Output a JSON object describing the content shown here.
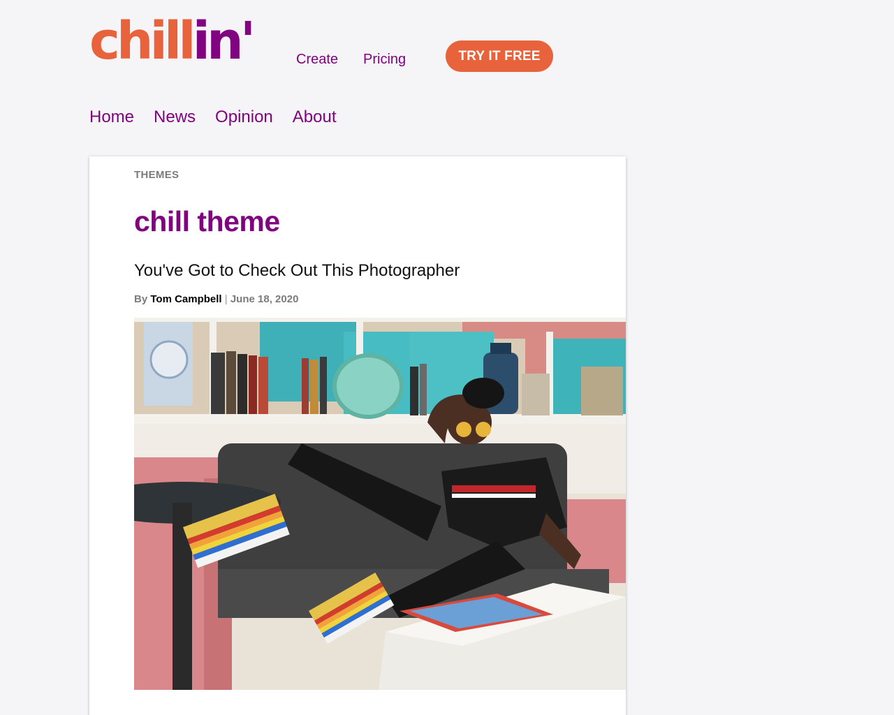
{
  "brand": {
    "logo_part1": "chill",
    "logo_part2": "in'",
    "orange": "#e8633b",
    "purple": "#800380"
  },
  "topnav": {
    "create": "Create",
    "pricing": "Pricing",
    "cta": "TRY IT FREE"
  },
  "mainnav": {
    "items": [
      "Home",
      "News",
      "Opinion",
      "About"
    ]
  },
  "article": {
    "category": "THEMES",
    "title": "chill theme",
    "headline": "You've Got to Check Out This Photographer",
    "by": "By",
    "author": "Tom Campbell",
    "separator": "|",
    "date": "June 18, 2020"
  }
}
